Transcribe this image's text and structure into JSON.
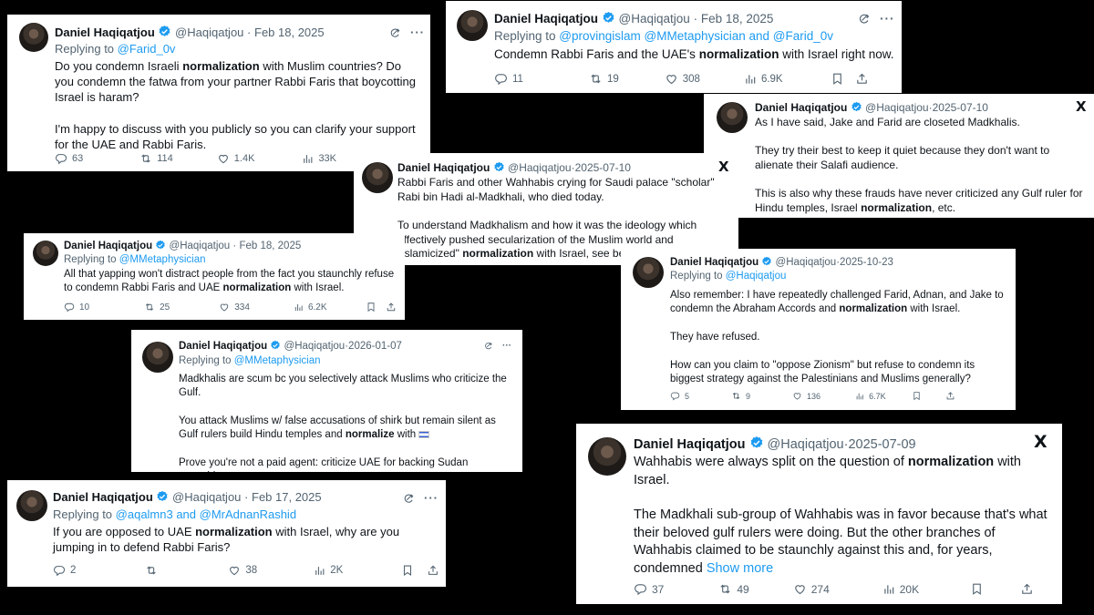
{
  "author": {
    "name": "Daniel Haqiqatjou",
    "handle": "@Haqiqatjou",
    "dot": "·"
  },
  "show_more": "Show more",
  "colors": {
    "verified": "#1d9bf0",
    "link": "#1d9bf0",
    "muted": "#536471",
    "background": "#000000"
  },
  "icons": [
    "verified-badge-icon",
    "grok-icon",
    "more-icon",
    "x-logo-icon",
    "reply-icon",
    "repost-icon",
    "like-icon",
    "views-icon",
    "bookmark-icon",
    "share-icon"
  ],
  "tweets": [
    {
      "date": "Feb 18, 2025",
      "replying_prefix": "Replying to ",
      "replying_to": "@Farid_0v",
      "replying_suffix": "",
      "p1": {
        "a": "Do you condemn Israeli ",
        "b": "normalization",
        "c": " with Muslim countries? Do you condemn the fatwa from your partner Rabbi Faris that boycotting Israel is haram?"
      },
      "p2": "I'm happy to discuss with you publicly so you can clarify your support for the UAE and Rabbi Faris.",
      "stats": {
        "replies": "63",
        "reposts": "114",
        "likes": "1.4K",
        "views": "33K"
      }
    },
    {
      "date": "Feb 18, 2025",
      "replying_prefix": "Replying to ",
      "replying_to": "@provingislam @MMetaphysician and @Farid_0v",
      "replying_suffix": "",
      "p1": {
        "a": "Condemn Rabbi Faris and the UAE's ",
        "b": "normalization",
        "c": " with Israel right now."
      },
      "stats": {
        "replies": "11",
        "reposts": "19",
        "likes": "308",
        "views": "6.9K"
      }
    },
    {
      "date": "2025-07-10",
      "p1": "As I have said, Jake and Farid are closeted Madkhalis.",
      "p2": "They try their best to keep it quiet because they don't want to alienate their Salafi audience.",
      "p3": {
        "a": "This is also why these frauds have never criticized any Gulf ruler for Hindu temples, Israel ",
        "b": "normalization",
        "c": ", etc."
      }
    },
    {
      "date": "2025-07-10",
      "p1": "Rabbi Faris and other Wahhabis crying for Saudi palace \"scholar\" Rabi bin Hadi al-Madkhali, who died today.",
      "p2": {
        "a": "To understand Madkhalism and how it was the ideology which effectively pushed secularization of the Muslim world and \"Islamicized\" ",
        "b": "normalization",
        "c": " with Israel, see below."
      }
    },
    {
      "date": "Feb 18, 2025",
      "replying_prefix": "Replying to ",
      "replying_to": "@MMetaphysician",
      "replying_suffix": "",
      "p1": {
        "a": "All that yapping won't distract people from the fact you staunchly refuse to condemn Rabbi Faris and UAE ",
        "b": "normalization",
        "c": " with Israel."
      },
      "stats": {
        "replies": "10",
        "reposts": "25",
        "likes": "334",
        "views": "6.2K"
      }
    },
    {
      "date": "2025-10-23",
      "replying_prefix": "Replying to ",
      "replying_to": "@Haqiqatjou",
      "replying_suffix": "",
      "p1": {
        "a": "Also remember: I have repeatedly challenged Farid, Adnan, and Jake to condemn the Abraham Accords and ",
        "b": "normalization",
        "c": " with Israel."
      },
      "p2": "They have refused.",
      "p3": "How can you claim to \"oppose Zionism\" but refuse to condemn its biggest strategy against the Palestinians and Muslims generally?",
      "stats": {
        "replies": "5",
        "reposts": "9",
        "likes": "136",
        "views": "6.7K"
      }
    },
    {
      "date": "2026-01-07",
      "replying_prefix": "Replying to ",
      "replying_to": "@MMetaphysician",
      "replying_suffix": "",
      "p1": "Madkhalis are scum bc you selectively attack Muslims who criticize the Gulf.",
      "p2": {
        "a": "You attack Muslims w/ false accusations of shirk but remain silent as Gulf rulers build Hindu temples and ",
        "b": "normalize",
        "c": " with "
      },
      "p3": "Prove you're not a paid agent: criticize UAE for backing Sudan genocide."
    },
    {
      "date": "Feb 17, 2025",
      "replying_prefix": "Replying to ",
      "replying_to": "@aqalmn3 and @MrAdnanRashid",
      "replying_suffix": "",
      "p1": {
        "a": "If you are opposed to UAE ",
        "b": "normalization",
        "c": " with Israel, why are you jumping in to defend Rabbi Faris?"
      },
      "stats": {
        "replies": "2",
        "reposts": "",
        "likes": "38",
        "views": "2K"
      }
    },
    {
      "date": "2025-07-09",
      "p1": {
        "a": "Wahhabis were always split on the question of ",
        "b": "normalization",
        "c": " with Israel."
      },
      "p2": "The Madkhali sub-group of Wahhabis was in favor because that's what their beloved gulf rulers were doing. But the other branches of Wahhabis claimed to be staunchly against this and, for years, condemned",
      "stats": {
        "replies": "37",
        "reposts": "49",
        "likes": "274",
        "views": "20K"
      }
    }
  ]
}
